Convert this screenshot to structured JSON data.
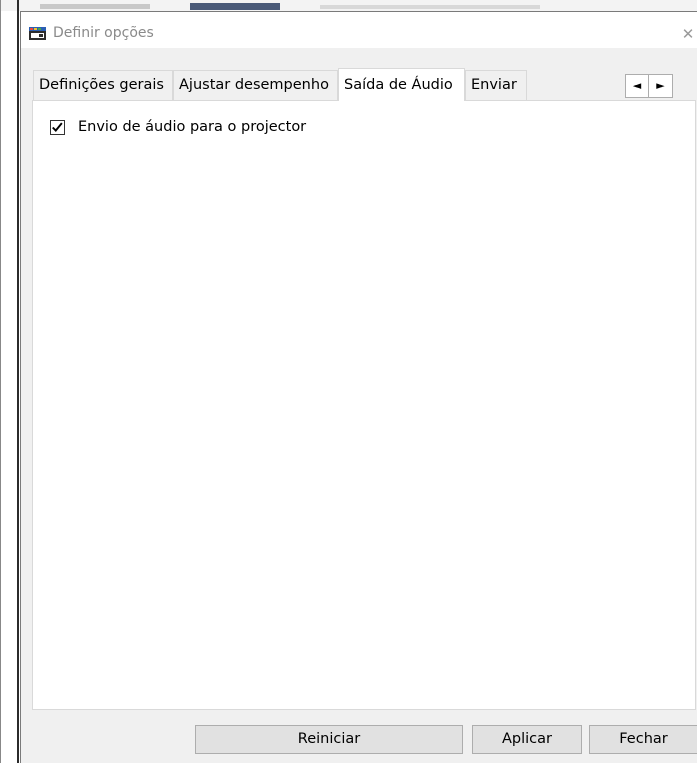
{
  "window": {
    "title": "Definir opções",
    "close_glyph": "✕"
  },
  "tabs": [
    {
      "label": "Definições gerais",
      "active": false
    },
    {
      "label": "Ajustar desempenho",
      "active": false
    },
    {
      "label": "Saída de Áudio",
      "active": true
    },
    {
      "label": "Enviar",
      "active": false
    }
  ],
  "tab_scroll": {
    "left_glyph": "◄",
    "right_glyph": "►"
  },
  "panel": {
    "audio_checkbox": {
      "label": "Envio de áudio para o projector",
      "checked": true
    }
  },
  "buttons": {
    "reset": "Reiniciar",
    "apply": "Aplicar",
    "close": "Fechar"
  },
  "icons": {
    "app": "projector-app-icon",
    "close": "close-icon",
    "scroll_left": "triangle-left-icon",
    "scroll_right": "triangle-right-icon",
    "check": "checkmark-icon"
  },
  "colors": {
    "window_bg": "#f0f0f0",
    "panel_bg": "#ffffff",
    "button_bg": "#e1e1e1",
    "title_text": "#8a8a8a"
  }
}
